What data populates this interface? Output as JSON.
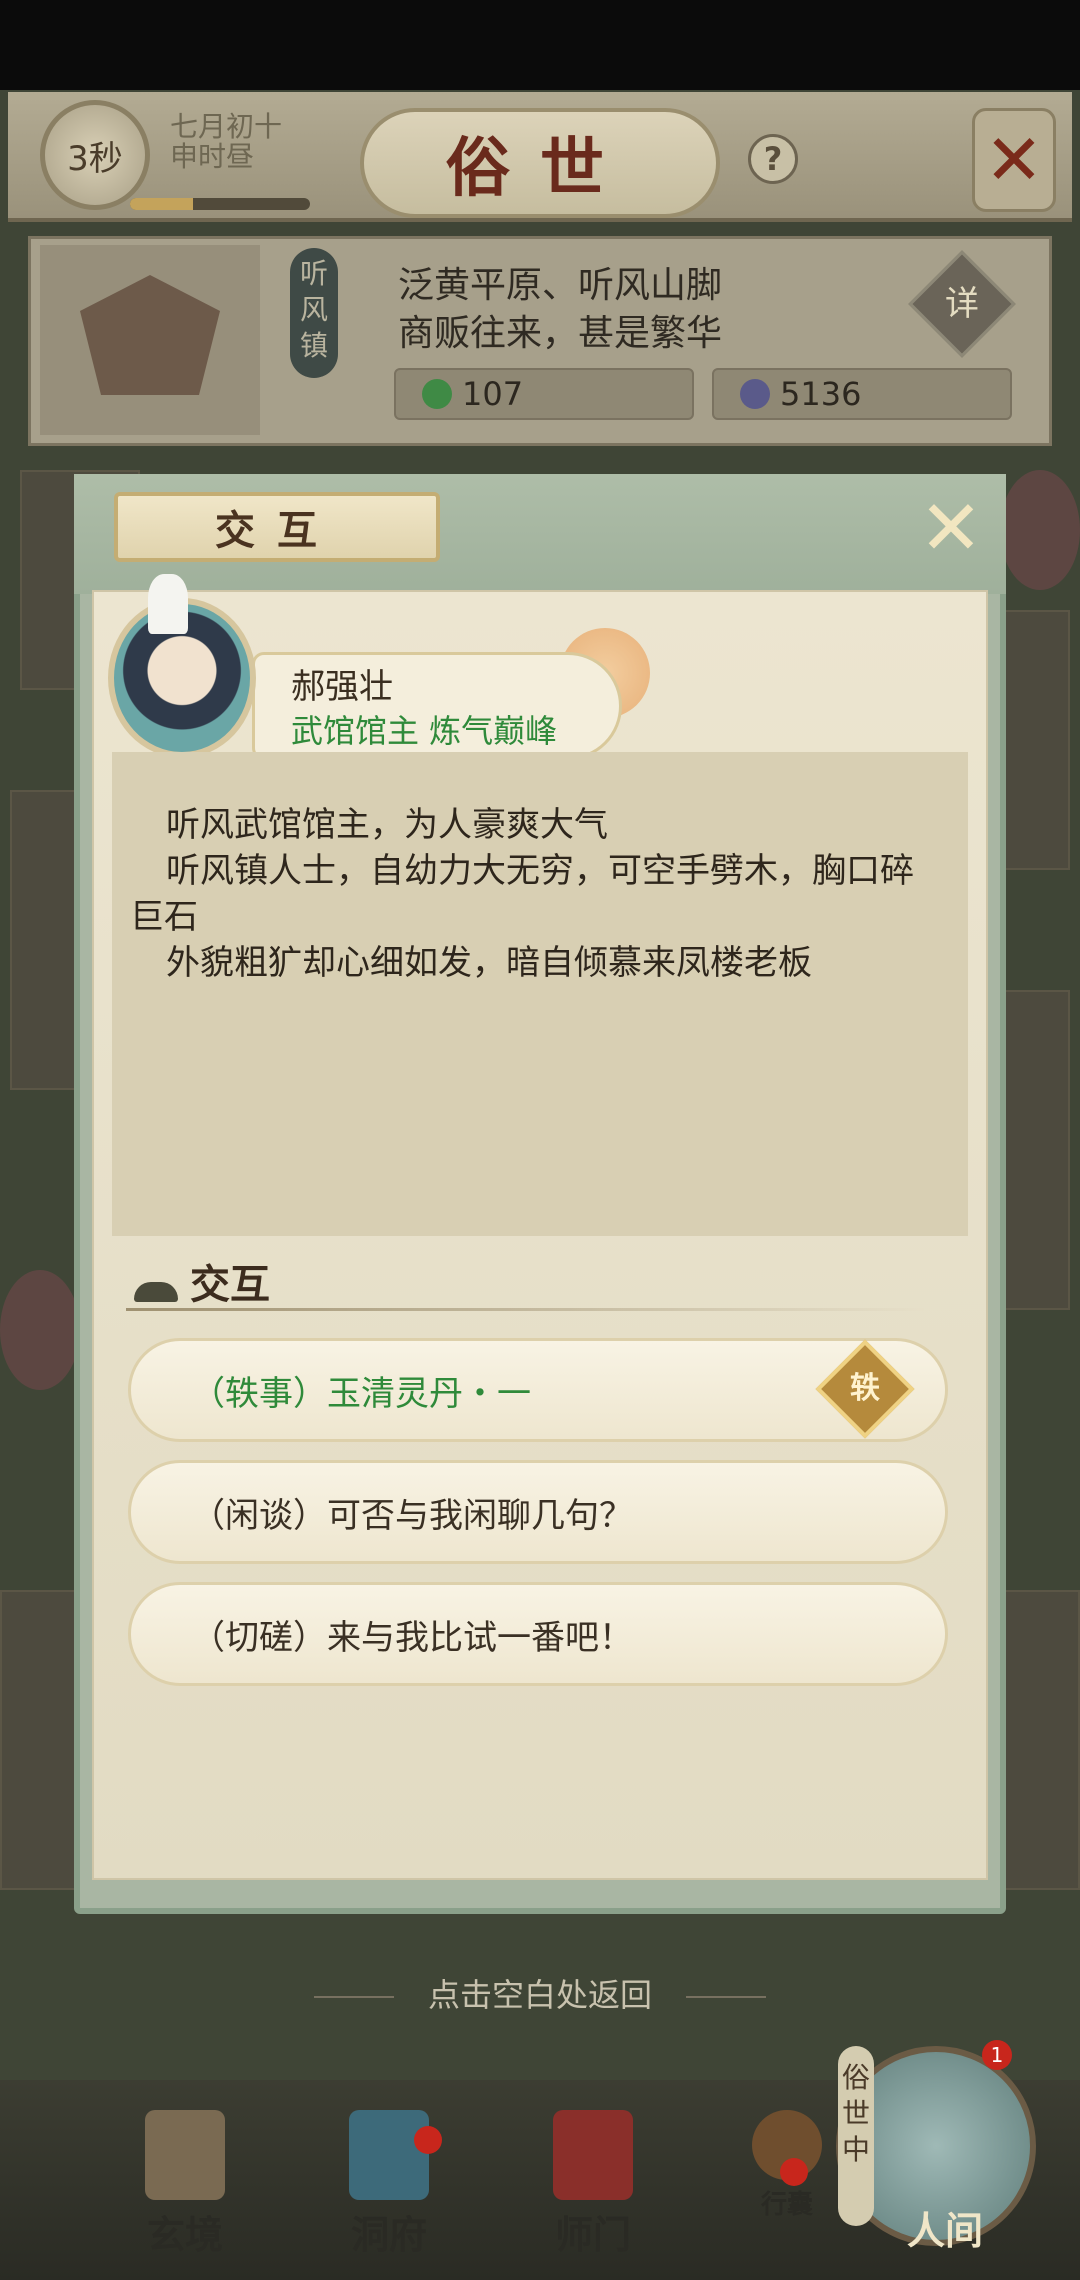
{
  "topbar": {
    "timer": "3秒",
    "date": "七月初十",
    "period": "申时昼",
    "time_progress": 0.35,
    "title": "俗世",
    "help_icon": "question-icon",
    "close_icon": "close-icon"
  },
  "location": {
    "sign": "听风镇",
    "desc_line1": "泛黄平原、听风山脚",
    "desc_line2": "商贩往来，甚是繁华",
    "detail_label": "详",
    "resource_a": "107",
    "resource_b": "5136"
  },
  "dialog": {
    "title": "交互",
    "npc": {
      "name": "郝强壮",
      "role": "武馆馆主 炼气巅峰"
    },
    "bio": [
      "听风武馆馆主，为人豪爽大气",
      "听风镇人士，自幼力大无穷，可空手劈木，胸口碎巨石",
      "外貌粗犷却心细如发，暗自倾慕来凤楼老板"
    ],
    "section_title": "交互",
    "options": [
      "（轶事）玉清灵丹・一",
      "（闲谈）可否与我闲聊几句？",
      "（切磋）来与我比试一番吧！"
    ],
    "badge_label": "轶",
    "hint": "点击空白处返回"
  },
  "nav": {
    "items": [
      "玄境",
      "洞府",
      "师门",
      "行囊"
    ],
    "world_label": "俗世中",
    "world_count": "1",
    "active": "人间"
  },
  "colors": {
    "accent_green": "#2f8a3a",
    "title_red": "#6a2a1c",
    "badge_red": "#c8261c"
  }
}
